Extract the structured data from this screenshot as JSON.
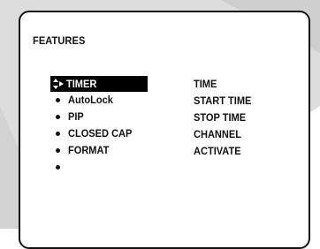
{
  "colors": {
    "backdrop_light": "#dcdcdc",
    "backdrop_mid": "#c9c9c9",
    "panel": "#ffffff",
    "border": "#111111",
    "text": "#111111",
    "selection": "#000000",
    "selection_text": "#ffffff"
  },
  "panel": {
    "title": "FEATURES"
  },
  "menu": {
    "items": [
      {
        "label": "TIMER",
        "selected": true,
        "icon": "up-down-right-arrows-icon"
      },
      {
        "label": "AutoLock",
        "selected": false,
        "icon": "bullet-icon"
      },
      {
        "label": "PIP",
        "selected": false,
        "icon": "bullet-icon"
      },
      {
        "label": "CLOSED CAP",
        "selected": false,
        "icon": "bullet-icon"
      },
      {
        "label": "FORMAT",
        "selected": false,
        "icon": "bullet-icon"
      },
      {
        "label": "",
        "selected": false,
        "icon": "bullet-icon"
      }
    ]
  },
  "submenu": {
    "items": [
      {
        "label": "TIME"
      },
      {
        "label": "START TIME"
      },
      {
        "label": "STOP TIME"
      },
      {
        "label": "CHANNEL"
      },
      {
        "label": "ACTIVATE"
      }
    ]
  }
}
